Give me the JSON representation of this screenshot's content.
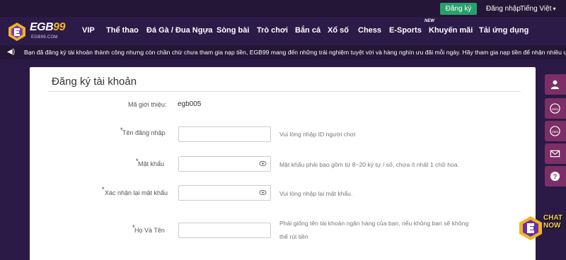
{
  "topbar": {
    "register_label": "Đăng ký",
    "login_label": "Đăng nhập",
    "language_label": "Tiếng Việt"
  },
  "brand": {
    "logo_text_main": "EGB",
    "logo_text_accent": "99",
    "logo_subtext": "EGB99.COM"
  },
  "nav": {
    "items": [
      {
        "label": "VIP"
      },
      {
        "label": "Thể thao"
      },
      {
        "label": "Đá Gà / Đua Ngựa"
      },
      {
        "label": "Sòng bài"
      },
      {
        "label": "Trò chơi"
      },
      {
        "label": "Bắn cá"
      },
      {
        "label": "Xổ số"
      },
      {
        "label": "Chess"
      },
      {
        "label": "E-Sports"
      },
      {
        "label": "Khuyến mãi"
      },
      {
        "label": "Tải ứng dụng"
      }
    ],
    "new_badge": "NEW"
  },
  "marquee": {
    "text": "Bạn đã đăng ký tài khoản thành công nhưng còn chần chừ chưa tham gia nạp tiền, EGB99 mang đến những trải nghiệm tuyệt vời và hàng nghìn ưu đãi mỗi ngày. Hãy tham gia nạp tiền để nhận nhiều ưu đãi nhé"
  },
  "form": {
    "title": "Đăng ký tài khoản",
    "referral": {
      "label": "Mã giới thiệu",
      "value": "egb005"
    },
    "username": {
      "label": "Tên đăng nhập",
      "hint": "Vui lòng nhập ID người chơi",
      "value": ""
    },
    "password": {
      "label": "Mật khẩu",
      "hint": "Mật khẩu phải bao gồm từ 8~20 ký tự / số, chứa ít nhất 1 chữ hoa.",
      "value": ""
    },
    "confirm": {
      "label": "Xác nhận lại mật khẩu",
      "hint": "Vui lòng nhập lại mật khẩu.",
      "value": ""
    },
    "fullname": {
      "label": "Họ Và Tên",
      "hint": "Phải giống tên tài khoản ngân hàng của bạn, nếu không bạn sẽ không thể rút tiền",
      "value": ""
    },
    "required_mark": "*",
    "colon": ":"
  },
  "side_buttons": [
    {
      "icon": "user-icon"
    },
    {
      "icon": "zalo-icon",
      "label": "Zalo"
    },
    {
      "icon": "zalo-icon",
      "label": "Zalo"
    },
    {
      "icon": "mail-icon"
    },
    {
      "icon": "help-icon",
      "label": "?"
    }
  ],
  "chat": {
    "line1": "CHAT",
    "line2": "NOW"
  },
  "colors": {
    "background": "#2a1a45",
    "register_green": "#27a06b",
    "side_button": "#7b2f66",
    "logo_accent": "#f2b51e"
  }
}
